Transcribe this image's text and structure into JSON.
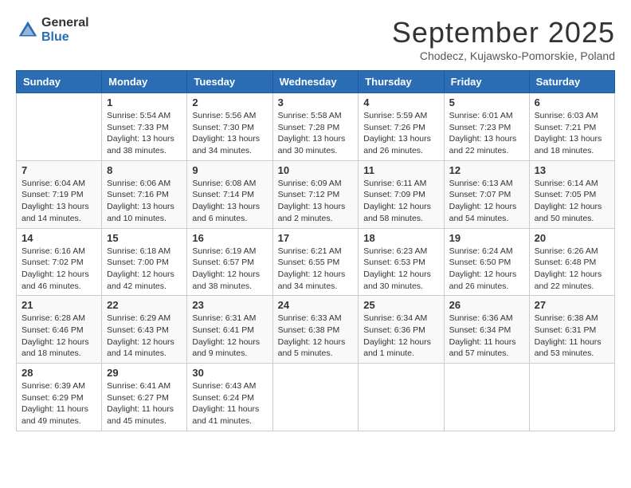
{
  "logo": {
    "general": "General",
    "blue": "Blue"
  },
  "title": "September 2025",
  "subtitle": "Chodecz, Kujawsko-Pomorskie, Poland",
  "days_of_week": [
    "Sunday",
    "Monday",
    "Tuesday",
    "Wednesday",
    "Thursday",
    "Friday",
    "Saturday"
  ],
  "weeks": [
    [
      {
        "day": "",
        "sunrise": "",
        "sunset": "",
        "daylight": ""
      },
      {
        "day": "1",
        "sunrise": "Sunrise: 5:54 AM",
        "sunset": "Sunset: 7:33 PM",
        "daylight": "Daylight: 13 hours and 38 minutes."
      },
      {
        "day": "2",
        "sunrise": "Sunrise: 5:56 AM",
        "sunset": "Sunset: 7:30 PM",
        "daylight": "Daylight: 13 hours and 34 minutes."
      },
      {
        "day": "3",
        "sunrise": "Sunrise: 5:58 AM",
        "sunset": "Sunset: 7:28 PM",
        "daylight": "Daylight: 13 hours and 30 minutes."
      },
      {
        "day": "4",
        "sunrise": "Sunrise: 5:59 AM",
        "sunset": "Sunset: 7:26 PM",
        "daylight": "Daylight: 13 hours and 26 minutes."
      },
      {
        "day": "5",
        "sunrise": "Sunrise: 6:01 AM",
        "sunset": "Sunset: 7:23 PM",
        "daylight": "Daylight: 13 hours and 22 minutes."
      },
      {
        "day": "6",
        "sunrise": "Sunrise: 6:03 AM",
        "sunset": "Sunset: 7:21 PM",
        "daylight": "Daylight: 13 hours and 18 minutes."
      }
    ],
    [
      {
        "day": "7",
        "sunrise": "Sunrise: 6:04 AM",
        "sunset": "Sunset: 7:19 PM",
        "daylight": "Daylight: 13 hours and 14 minutes."
      },
      {
        "day": "8",
        "sunrise": "Sunrise: 6:06 AM",
        "sunset": "Sunset: 7:16 PM",
        "daylight": "Daylight: 13 hours and 10 minutes."
      },
      {
        "day": "9",
        "sunrise": "Sunrise: 6:08 AM",
        "sunset": "Sunset: 7:14 PM",
        "daylight": "Daylight: 13 hours and 6 minutes."
      },
      {
        "day": "10",
        "sunrise": "Sunrise: 6:09 AM",
        "sunset": "Sunset: 7:12 PM",
        "daylight": "Daylight: 13 hours and 2 minutes."
      },
      {
        "day": "11",
        "sunrise": "Sunrise: 6:11 AM",
        "sunset": "Sunset: 7:09 PM",
        "daylight": "Daylight: 12 hours and 58 minutes."
      },
      {
        "day": "12",
        "sunrise": "Sunrise: 6:13 AM",
        "sunset": "Sunset: 7:07 PM",
        "daylight": "Daylight: 12 hours and 54 minutes."
      },
      {
        "day": "13",
        "sunrise": "Sunrise: 6:14 AM",
        "sunset": "Sunset: 7:05 PM",
        "daylight": "Daylight: 12 hours and 50 minutes."
      }
    ],
    [
      {
        "day": "14",
        "sunrise": "Sunrise: 6:16 AM",
        "sunset": "Sunset: 7:02 PM",
        "daylight": "Daylight: 12 hours and 46 minutes."
      },
      {
        "day": "15",
        "sunrise": "Sunrise: 6:18 AM",
        "sunset": "Sunset: 7:00 PM",
        "daylight": "Daylight: 12 hours and 42 minutes."
      },
      {
        "day": "16",
        "sunrise": "Sunrise: 6:19 AM",
        "sunset": "Sunset: 6:57 PM",
        "daylight": "Daylight: 12 hours and 38 minutes."
      },
      {
        "day": "17",
        "sunrise": "Sunrise: 6:21 AM",
        "sunset": "Sunset: 6:55 PM",
        "daylight": "Daylight: 12 hours and 34 minutes."
      },
      {
        "day": "18",
        "sunrise": "Sunrise: 6:23 AM",
        "sunset": "Sunset: 6:53 PM",
        "daylight": "Daylight: 12 hours and 30 minutes."
      },
      {
        "day": "19",
        "sunrise": "Sunrise: 6:24 AM",
        "sunset": "Sunset: 6:50 PM",
        "daylight": "Daylight: 12 hours and 26 minutes."
      },
      {
        "day": "20",
        "sunrise": "Sunrise: 6:26 AM",
        "sunset": "Sunset: 6:48 PM",
        "daylight": "Daylight: 12 hours and 22 minutes."
      }
    ],
    [
      {
        "day": "21",
        "sunrise": "Sunrise: 6:28 AM",
        "sunset": "Sunset: 6:46 PM",
        "daylight": "Daylight: 12 hours and 18 minutes."
      },
      {
        "day": "22",
        "sunrise": "Sunrise: 6:29 AM",
        "sunset": "Sunset: 6:43 PM",
        "daylight": "Daylight: 12 hours and 14 minutes."
      },
      {
        "day": "23",
        "sunrise": "Sunrise: 6:31 AM",
        "sunset": "Sunset: 6:41 PM",
        "daylight": "Daylight: 12 hours and 9 minutes."
      },
      {
        "day": "24",
        "sunrise": "Sunrise: 6:33 AM",
        "sunset": "Sunset: 6:38 PM",
        "daylight": "Daylight: 12 hours and 5 minutes."
      },
      {
        "day": "25",
        "sunrise": "Sunrise: 6:34 AM",
        "sunset": "Sunset: 6:36 PM",
        "daylight": "Daylight: 12 hours and 1 minute."
      },
      {
        "day": "26",
        "sunrise": "Sunrise: 6:36 AM",
        "sunset": "Sunset: 6:34 PM",
        "daylight": "Daylight: 11 hours and 57 minutes."
      },
      {
        "day": "27",
        "sunrise": "Sunrise: 6:38 AM",
        "sunset": "Sunset: 6:31 PM",
        "daylight": "Daylight: 11 hours and 53 minutes."
      }
    ],
    [
      {
        "day": "28",
        "sunrise": "Sunrise: 6:39 AM",
        "sunset": "Sunset: 6:29 PM",
        "daylight": "Daylight: 11 hours and 49 minutes."
      },
      {
        "day": "29",
        "sunrise": "Sunrise: 6:41 AM",
        "sunset": "Sunset: 6:27 PM",
        "daylight": "Daylight: 11 hours and 45 minutes."
      },
      {
        "day": "30",
        "sunrise": "Sunrise: 6:43 AM",
        "sunset": "Sunset: 6:24 PM",
        "daylight": "Daylight: 11 hours and 41 minutes."
      },
      {
        "day": "",
        "sunrise": "",
        "sunset": "",
        "daylight": ""
      },
      {
        "day": "",
        "sunrise": "",
        "sunset": "",
        "daylight": ""
      },
      {
        "day": "",
        "sunrise": "",
        "sunset": "",
        "daylight": ""
      },
      {
        "day": "",
        "sunrise": "",
        "sunset": "",
        "daylight": ""
      }
    ]
  ]
}
